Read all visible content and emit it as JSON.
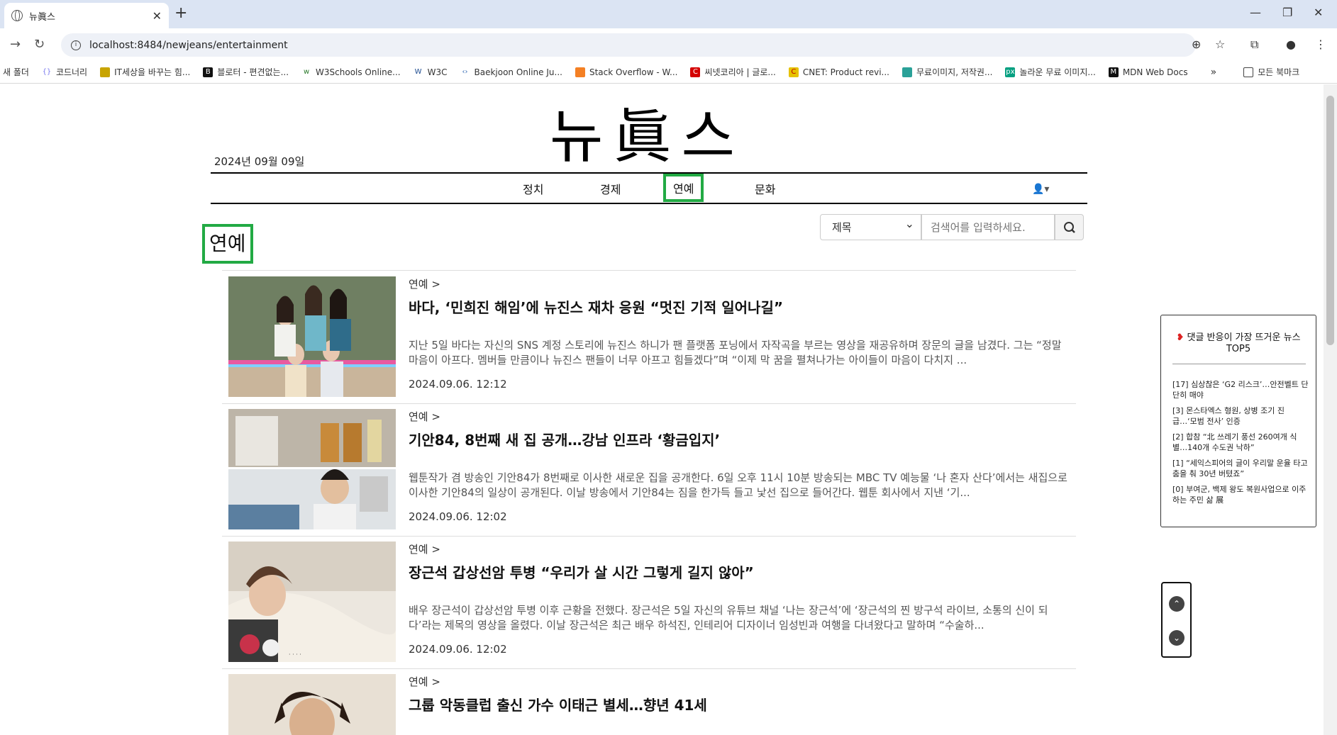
{
  "browser": {
    "tab_title": "뉴眞스",
    "url": "localhost:8484/newjeans/entertainment",
    "bookmarks": [
      "새 폴더",
      "코드너리",
      "IT세상을 바꾸는 힘...",
      "블로터 - 편견없는...",
      "W3Schools Online...",
      "W3C",
      "Baekjoon Online Ju...",
      "Stack Overflow - W...",
      "씨넷코리아 | 글로...",
      "CNET: Product revi...",
      "무료이미지, 저작권...",
      "놀라운 무료 이미지...",
      "MDN Web Docs"
    ],
    "all_bookmarks": "모든 북마크"
  },
  "header": {
    "logo": "뉴眞스",
    "date": "2024년 09월 09일",
    "menu": [
      "정치",
      "경제",
      "연예",
      "문화"
    ],
    "active_menu": "연예"
  },
  "section": {
    "title": "연예"
  },
  "search": {
    "select_value": "제목",
    "placeholder": "검색어를 입력하세요."
  },
  "articles": [
    {
      "category": "연예 >",
      "title": "바다, ‘민희진 해임’에 뉴진스 재차 응원 “멋진 기적 일어나길”",
      "summary": "지난 5일 바다는 자신의 SNS 계정 스토리에 뉴진스 하니가 팬 플랫폼 포닝에서 자작곡을 부르는 영상을 재공유하며 장문의 글을 남겼다. 그는 “정말 마음이 아프다. 멤버들 만큼이나 뉴진스 팬들이 너무 아프고 힘들겠다”며 “이제 막 꿈을 펼쳐나가는 아이들이 마음이 다치지 ...",
      "date": "2024.09.06. 12:12"
    },
    {
      "category": "연예 >",
      "title": "기안84, 8번째 새 집 공개…강남 인프라 ‘황금입지’",
      "summary": "웹툰작가 겸 방송인 기안84가 8번째로 이사한 새로운 집을 공개한다. 6일 오후 11시 10분 방송되는 MBC TV 예능물 ‘나 혼자 산다’에서는 새집으로 이사한 기안84의 일상이 공개된다. 이날 방송에서 기안84는 짐을 한가득 들고 낯선 집으로 들어간다. 웹툰 회사에서 지낸 ‘기...",
      "date": "2024.09.06. 12:02"
    },
    {
      "category": "연예 >",
      "title": "장근석 갑상선암 투병 “우리가 살 시간 그렇게 길지 않아”",
      "summary": "배우 장근석이 갑상선암 투병 이후 근황을 전했다. 장근석은 5일 자신의 유튜브 채널 ‘나는 장근석’에 ‘장근석의 찐 방구석 라이브, 소통의 신이 되다’라는 제목의 영상을 올렸다. 이날 장근석은 최근 배우 하석진, 인테리어 디자이너 임성빈과 여행을 다녀왔다고 말하며 “수술하...",
      "date": "2024.09.06. 12:02"
    },
    {
      "category": "연예 >",
      "title": "그룹 악동클럽 출신 가수 이태근 별세…향년 41세",
      "summary": "",
      "date": ""
    }
  ],
  "hot_news": {
    "title": "댓글 반응이 가장 뜨거운 뉴스 TOP5",
    "items": [
      "[17] 심상찮은 ‘G2 리스크’…안전벨트 단단히 매야",
      "[3] 몬스타엑스 형원, 상병 조기 진급…‘모범 전사’ 인증",
      "[2] 합참 “北 쓰레기 풍선 260여개 식별…140개 수도권 낙하”",
      "[1] “세익스피어의 글이 우리말 운율 타고 춤을 춰 30년 버텼죠”",
      "[0] 부여군, 백제 왕도 복원사업으로 이주하는 주민 삶 展"
    ]
  },
  "colors": {
    "highlight": "#22aa44"
  }
}
